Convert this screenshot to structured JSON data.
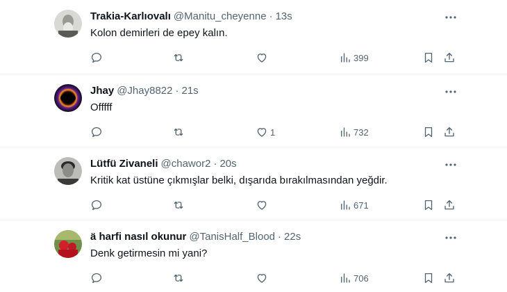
{
  "tweets": [
    {
      "name": "Trakia-Karlıovalı",
      "handle": "@Manitu_cheyenne",
      "time": "13s",
      "text": "Kolon demirleri de epey kalın.",
      "likes": "",
      "views": "399"
    },
    {
      "name": "Jhay",
      "handle": "@Jhay8822",
      "time": "21s",
      "text": "Offfff",
      "likes": "1",
      "views": "732"
    },
    {
      "name": "Lütfü Zivaneli",
      "handle": "@chawor2",
      "time": "20s",
      "text": "Kritik kat üstüne çıkmışlar belki, dışarıda bırakılmasından yeğdir.",
      "likes": "",
      "views": "671"
    },
    {
      "name": "ä harfi nasıl okunur",
      "handle": "@TanisHalf_Blood",
      "time": "22s",
      "text": "Denk getirmesin mi yani?",
      "likes": "",
      "views": "706"
    }
  ],
  "separator": "·",
  "icons": {
    "more": "more-horizontal-icon",
    "reply": "reply-bubble-icon",
    "retweet": "retweet-icon",
    "like": "heart-icon",
    "views": "views-bar-chart-icon",
    "bookmark": "bookmark-icon",
    "share": "share-upload-icon"
  },
  "colors": {
    "text": "#0f1419",
    "secondary": "#536471",
    "divider": "#eff3f4"
  }
}
